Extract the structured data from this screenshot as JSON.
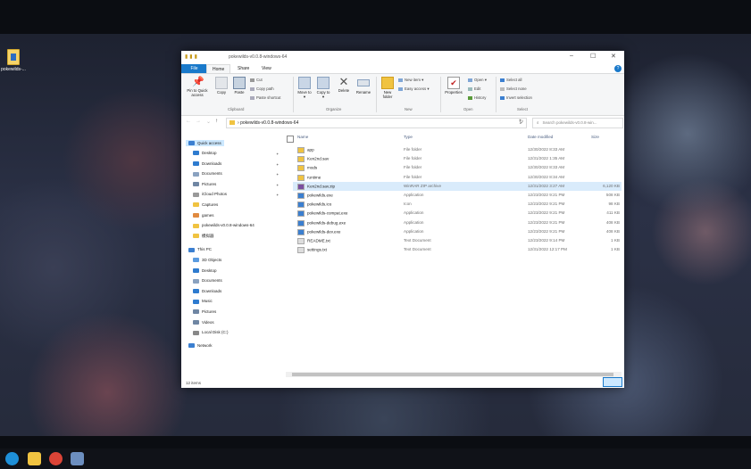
{
  "desktop": {
    "icon_label": "pokewilds-..."
  },
  "window": {
    "title": "pokewilds-v0.0.8-windows-64",
    "controls": {
      "minimize": "–",
      "maximize": "☐",
      "close": "✕"
    },
    "tabs": {
      "file": "File",
      "home": "Home",
      "share": "Share",
      "view": "View"
    },
    "help": "?"
  },
  "ribbon": {
    "pin": "Pin to Quick access",
    "copy": "Copy",
    "paste": "Paste",
    "cut": "Cut",
    "copy_path": "Copy path",
    "paste_shortcut": "Paste shortcut",
    "clipboard": "Clipboard",
    "move_to": "Move to ▾",
    "copy_to": "Copy to ▾",
    "delete": "Delete",
    "rename": "Rename",
    "organize": "Organize",
    "new_folder": "New folder",
    "new_item": "New item ▾",
    "easy_access": "Easy access ▾",
    "new": "New",
    "properties": "Properties",
    "open": "Open ▾",
    "edit": "Edit",
    "history": "History",
    "open_group": "Open",
    "select_all": "Select all",
    "select_none": "Select none",
    "invert_selection": "Invert selection",
    "select_group": "Select"
  },
  "address": {
    "path_chevron": "›",
    "path": "pokewilds-v0.0.8-windows-64",
    "search_placeholder": "Search pokewilds-v0.0.8-win..."
  },
  "nav": {
    "quick_access": "Quick access",
    "quick": [
      "Desktop",
      "Downloads",
      "Documents",
      "Pictures",
      "iCloud Photos",
      "Captures",
      "games",
      "pokewilds-v0.0.8-windows-64",
      "模拟器"
    ],
    "this_pc": "This PC",
    "pc": [
      "3D Objects",
      "Desktop",
      "Documents",
      "Downloads",
      "Music",
      "Pictures",
      "Videos",
      "Local Disk (C:)"
    ],
    "network": "Network"
  },
  "columns": {
    "name": "Name",
    "type": "Type",
    "date": "Date modified",
    "size": "Size"
  },
  "files": [
    {
      "name": "app",
      "type": "File folder",
      "date": "12/30/2022 8:33 AM",
      "size": "",
      "kind": "folder"
    },
    {
      "name": "Ken2nd.sav",
      "type": "File folder",
      "date": "12/31/2022 1:35 AM",
      "size": "",
      "kind": "folder"
    },
    {
      "name": "mods",
      "type": "File folder",
      "date": "12/30/2022 8:33 AM",
      "size": "",
      "kind": "folder"
    },
    {
      "name": "runtime",
      "type": "File folder",
      "date": "12/30/2022 8:34 AM",
      "size": "",
      "kind": "folder"
    },
    {
      "name": "Ken2nd.sav.zip",
      "type": "WinRAR ZIP archive",
      "date": "12/31/2022 3:27 AM",
      "size": "6,120 KB",
      "kind": "zip"
    },
    {
      "name": "pokewilds.exe",
      "type": "Application",
      "date": "12/23/2022 9:21 PM",
      "size": "508 KB",
      "kind": "app"
    },
    {
      "name": "pokewilds.ico",
      "type": "Icon",
      "date": "12/23/2022 9:21 PM",
      "size": "98 KB",
      "kind": "ico"
    },
    {
      "name": "pokewilds-compat.exe",
      "type": "Application",
      "date": "12/23/2022 9:21 PM",
      "size": "411 KB",
      "kind": "app"
    },
    {
      "name": "pokewilds-debug.exe",
      "type": "Application",
      "date": "12/23/2022 9:21 PM",
      "size": "408 KB",
      "kind": "app"
    },
    {
      "name": "pokewilds-dev.exe",
      "type": "Application",
      "date": "12/23/2022 9:21 PM",
      "size": "408 KB",
      "kind": "app"
    },
    {
      "name": "README.txt",
      "type": "Text Document",
      "date": "12/23/2022 9:14 PM",
      "size": "1 KB",
      "kind": "txt"
    },
    {
      "name": "settings.txt",
      "type": "Text Document",
      "date": "12/31/2022 12:17 PM",
      "size": "1 KB",
      "kind": "txt"
    }
  ],
  "status": {
    "count": "12 items"
  },
  "colors": {
    "accent": "#1979ca",
    "folder": "#f0c341",
    "selection": "#d9ebfb"
  }
}
